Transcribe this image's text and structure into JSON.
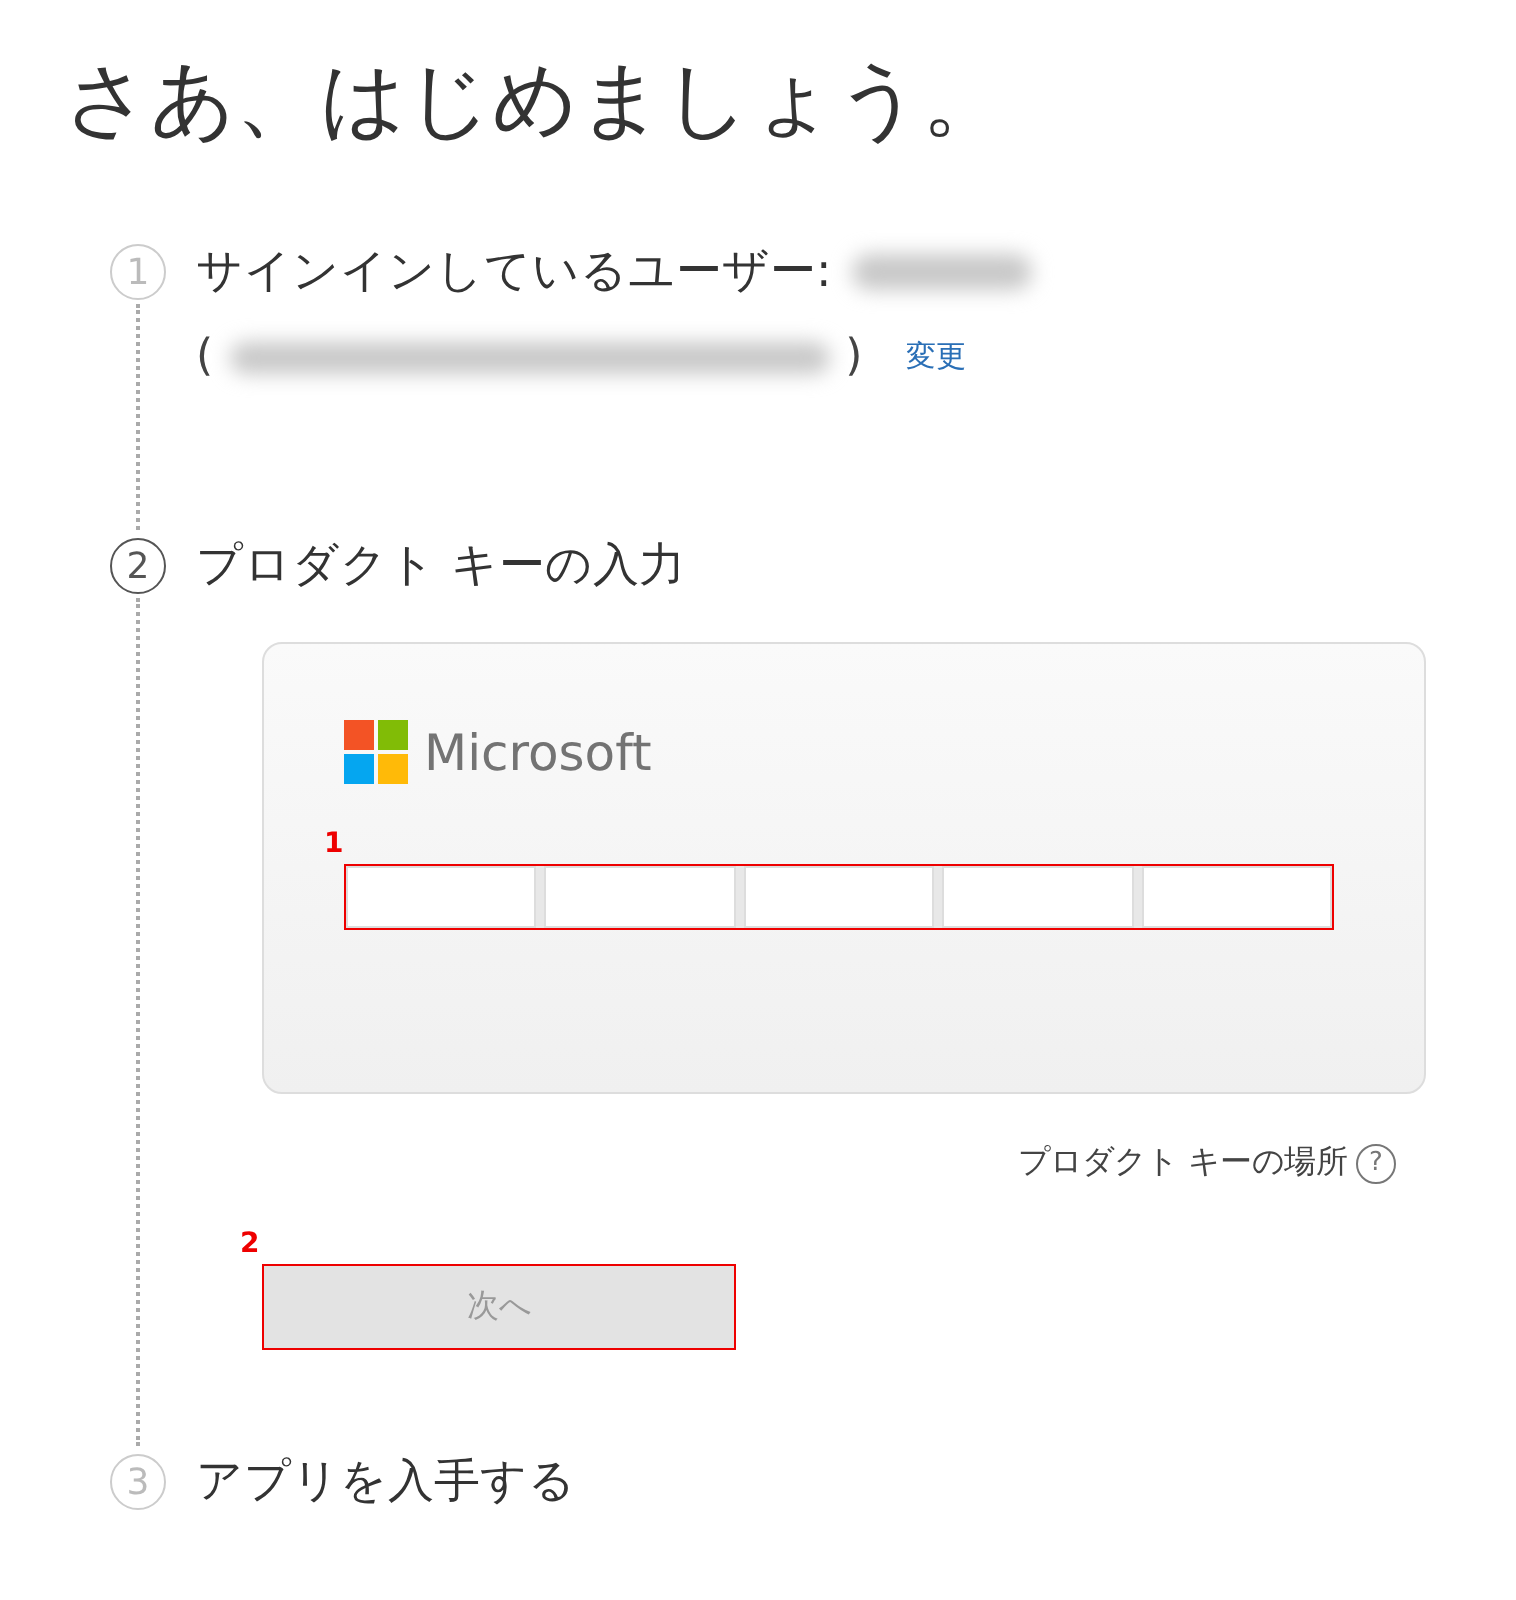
{
  "title": "さあ、はじめましょう。",
  "steps": [
    {
      "number": "1",
      "label": "サインインしているユーザー:",
      "current": false,
      "kind": "account",
      "open_paren": "(",
      "close_paren": ")",
      "change_link": "変更"
    },
    {
      "number": "2",
      "label": "プロダクト キーの入力",
      "current": true,
      "kind": "product_key",
      "brand": "Microsoft",
      "key_annotation": "1",
      "help_link": "プロダクト キーの場所",
      "help_icon": "?",
      "next_button": {
        "label": "次へ",
        "disabled": true,
        "annotation": "2"
      }
    },
    {
      "number": "3",
      "label": "アプリを入手する",
      "current": false,
      "kind": "plain"
    }
  ]
}
